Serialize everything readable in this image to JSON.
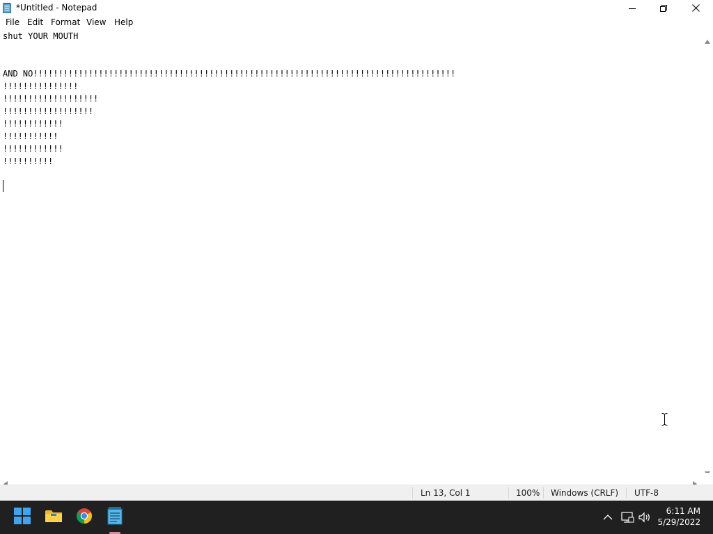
{
  "window": {
    "title": "*Untitled - Notepad",
    "controls": {
      "minimize": "minimize",
      "maximize": "restore",
      "close": "close"
    }
  },
  "menu": {
    "items": [
      {
        "label": "File"
      },
      {
        "label": "Edit"
      },
      {
        "label": "Format"
      },
      {
        "label": "View"
      },
      {
        "label": "Help"
      }
    ]
  },
  "editor": {
    "lines": [
      "shut YOUR MOUTH",
      "",
      "",
      "AND NO!!!!!!!!!!!!!!!!!!!!!!!!!!!!!!!!!!!!!!!!!!!!!!!!!!!!!!!!!!!!!!!!!!!!!!!!!!!!!!!!!!!!",
      "!!!!!!!!!!!!!!!",
      "!!!!!!!!!!!!!!!!!!!",
      "!!!!!!!!!!!!!!!!!!",
      "!!!!!!!!!!!!",
      "!!!!!!!!!!!",
      "!!!!!!!!!!!!",
      "!!!!!!!!!!",
      "",
      ""
    ]
  },
  "status": {
    "position": "Ln 13, Col 1",
    "zoom": "100%",
    "line_ending": "Windows (CRLF)",
    "encoding": "UTF-8"
  },
  "taskbar": {
    "apps": [
      {
        "icon": "windows-start-icon"
      },
      {
        "icon": "file-explorer-icon"
      },
      {
        "icon": "chrome-icon"
      },
      {
        "icon": "notepad-icon",
        "active": true
      }
    ],
    "tray": {
      "time": "6:11 AM",
      "date": "5/29/2022"
    }
  },
  "colors": {
    "taskbar": "#202020",
    "accent_indicator": "#d78aa0",
    "statusbar": "#f0f0f0"
  }
}
